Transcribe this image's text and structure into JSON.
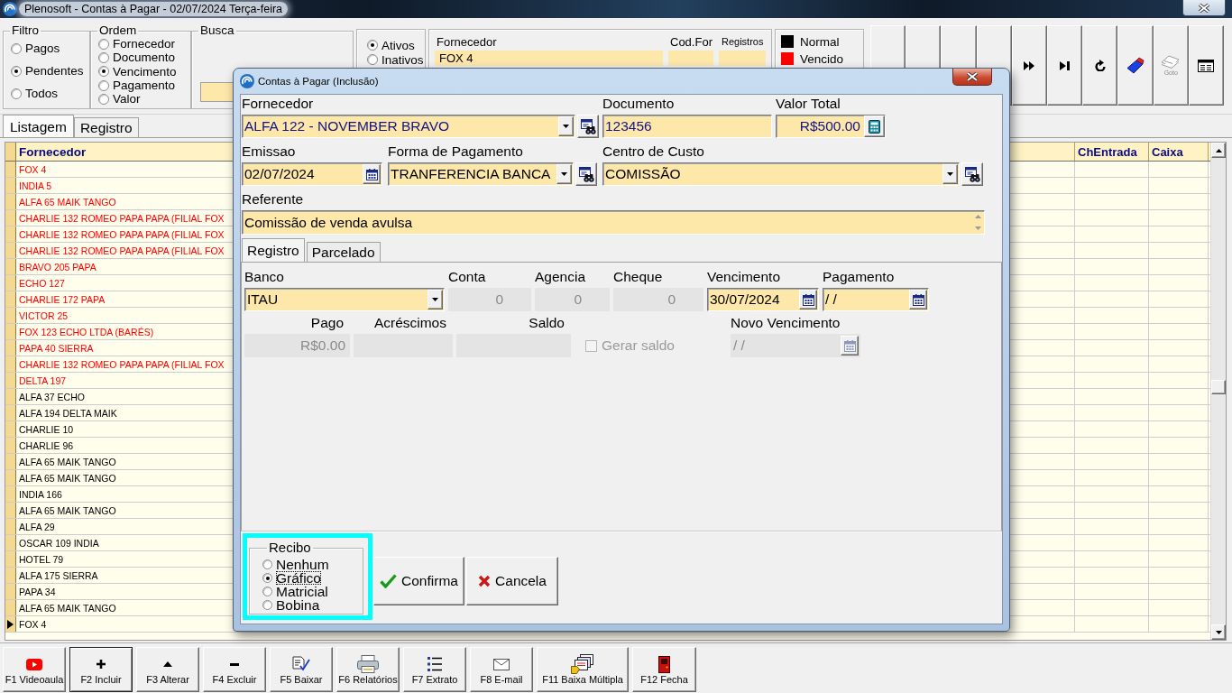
{
  "window": {
    "title": "Plenosoft - Contas à Pagar - 02/07/2024 Terça-feira"
  },
  "filter": {
    "legend": "Filtro",
    "options": [
      {
        "label": "Pagos",
        "selected": false
      },
      {
        "label": "Pendentes",
        "selected": true
      },
      {
        "label": "Todos",
        "selected": false
      }
    ]
  },
  "order": {
    "legend": "Ordem",
    "options": [
      {
        "label": "Fornecedor",
        "selected": false
      },
      {
        "label": "Documento",
        "selected": false
      },
      {
        "label": "Vencimento",
        "selected": true
      },
      {
        "label": "Pagamento",
        "selected": false
      },
      {
        "label": "Valor",
        "selected": false
      }
    ]
  },
  "search": {
    "legend": "Busca"
  },
  "activity": {
    "options": [
      {
        "label": "Ativos",
        "selected": true
      },
      {
        "label": "Inativos",
        "selected": false
      }
    ]
  },
  "lookup_fields": [
    {
      "label": "Fornecedor",
      "value": "FOX 4"
    },
    {
      "label": "Cod.For"
    },
    {
      "label": "Registros"
    }
  ],
  "status_legend": [
    {
      "label": "Normal",
      "color": "#000000"
    },
    {
      "label": "Vencido",
      "color": "#ff0000"
    }
  ],
  "nav_buttons": [
    {
      "kind": "blank"
    },
    {
      "kind": "blank"
    },
    {
      "kind": "blank"
    },
    {
      "kind": "blank"
    },
    {
      "kind": "next"
    },
    {
      "kind": "last"
    },
    {
      "kind": "refresh"
    },
    {
      "kind": "eraser"
    },
    {
      "kind": "goto",
      "caption": "Goto"
    },
    {
      "kind": "form"
    }
  ],
  "tabs": [
    {
      "label": "Listagem",
      "selected": true
    },
    {
      "label": "Registro",
      "selected": false
    }
  ],
  "table": {
    "columns": [
      "Fornecedor",
      "ChEntrada",
      "Caixa"
    ],
    "rows": [
      {
        "supplier": "FOX 4",
        "overdue": true,
        "selected": false
      },
      {
        "supplier": "INDIA 5",
        "overdue": true,
        "selected": false
      },
      {
        "supplier": "ALFA 65 MAIK TANGO",
        "overdue": true,
        "selected": false
      },
      {
        "supplier": "CHARLIE 132 ROMEO PAPA PAPA (FILIAL FOX",
        "overdue": true,
        "selected": false
      },
      {
        "supplier": "CHARLIE 132 ROMEO PAPA PAPA (FILIAL FOX",
        "overdue": true,
        "selected": false
      },
      {
        "supplier": "CHARLIE 132 ROMEO PAPA PAPA (FILIAL FOX",
        "overdue": true,
        "selected": false
      },
      {
        "supplier": "BRAVO 205 PAPA",
        "overdue": true,
        "selected": false
      },
      {
        "supplier": "ECHO 127",
        "overdue": true,
        "selected": false
      },
      {
        "supplier": "CHARLIE 172 PAPA",
        "overdue": true,
        "selected": false
      },
      {
        "supplier": "VICTOR 25",
        "overdue": true,
        "selected": false
      },
      {
        "supplier": "FOX 123 ECHO LTDA (BARÉS)",
        "overdue": true,
        "selected": false
      },
      {
        "supplier": "PAPA 40 SIERRA",
        "overdue": true,
        "selected": false
      },
      {
        "supplier": "CHARLIE 132 ROMEO PAPA PAPA (FILIAL FOX",
        "overdue": true,
        "selected": false
      },
      {
        "supplier": "DELTA 197",
        "overdue": true,
        "selected": false
      },
      {
        "supplier": "ALFA 37 ECHO",
        "overdue": false,
        "selected": false
      },
      {
        "supplier": "ALFA 194 DELTA MAIK",
        "overdue": false,
        "selected": false
      },
      {
        "supplier": "CHARLIE 10",
        "overdue": false,
        "selected": false
      },
      {
        "supplier": "CHARLIE 96",
        "overdue": false,
        "selected": false
      },
      {
        "supplier": "ALFA 65 MAIK TANGO",
        "overdue": false,
        "selected": false
      },
      {
        "supplier": "ALFA 65 MAIK TANGO",
        "overdue": false,
        "selected": false
      },
      {
        "supplier": "INDIA 166",
        "overdue": false,
        "selected": false
      },
      {
        "supplier": "ALFA 65 MAIK TANGO",
        "overdue": false,
        "selected": false
      },
      {
        "supplier": "ALFA 29",
        "overdue": false,
        "selected": false
      },
      {
        "supplier": "OSCAR 109 INDIA",
        "overdue": false,
        "selected": false
      },
      {
        "supplier": "HOTEL 79",
        "overdue": false,
        "selected": false
      },
      {
        "supplier": "ALFA 175 SIERRA",
        "overdue": false,
        "selected": false
      },
      {
        "supplier": "PAPA 34",
        "overdue": false,
        "selected": false
      },
      {
        "supplier": "ALFA 65 MAIK TANGO",
        "overdue": false,
        "selected": false
      },
      {
        "supplier": "FOX 4",
        "overdue": false,
        "selected": true
      }
    ]
  },
  "function_keys": [
    {
      "label": "F1 Videoaula",
      "kind": "video",
      "focused": false
    },
    {
      "label": "F2 Incluir",
      "kind": "add",
      "focused": true
    },
    {
      "label": "F3 Alterar",
      "kind": "edit",
      "focused": false
    },
    {
      "label": "F4 Excluir",
      "kind": "delete",
      "focused": false
    },
    {
      "label": "F5 Baixar",
      "kind": "settle",
      "focused": false
    },
    {
      "label": "F6 Relatórios",
      "kind": "reports",
      "focused": false
    },
    {
      "label": "F7 Extrato",
      "kind": "statement",
      "focused": false
    },
    {
      "label": "F8 E-mail",
      "kind": "email",
      "focused": false
    },
    {
      "label": "F11 Baixa Múltipla",
      "kind": "batch",
      "focused": false
    },
    {
      "label": "F12 Fecha",
      "kind": "exit",
      "focused": false
    }
  ],
  "dialog": {
    "title": "Contas à Pagar (Inclusão)",
    "field_rows": [
      [
        {
          "label": "Fornecedor",
          "value": "ALFA 122 - NOVEMBER BRAVO",
          "kind": "combo",
          "lookup": true,
          "disabled": false
        },
        {
          "label": "Documento",
          "value": "123456",
          "kind": "text",
          "disabled": false
        },
        {
          "label": "Valor Total",
          "value": "R$500.00",
          "kind": "number",
          "calculator": true,
          "disabled": false
        }
      ],
      [
        {
          "label": "Emissao",
          "value": "02/07/2024",
          "kind": "text",
          "calendar": true,
          "disabled": false
        },
        {
          "label": "Forma de Pagamento",
          "value": "TRANFERENCIA BANCA",
          "kind": "combo",
          "lookup": true,
          "disabled": false
        },
        {
          "label": "Centro de Custo",
          "value": "COMISSÃO",
          "kind": "combo",
          "lookup": true,
          "disabled": false
        }
      ],
      [
        {
          "label": "Referente",
          "value": "Comissão de venda avulsa",
          "kind": "memo",
          "disabled": false
        }
      ]
    ],
    "tabs": [
      {
        "label": "Registro",
        "selected": true
      },
      {
        "label": "Parcelado",
        "selected": false
      }
    ],
    "tab_rows": [
      [
        {
          "label": "Banco",
          "value": "ITAU",
          "kind": "combo",
          "disabled": false
        },
        {
          "label": "Conta",
          "value": "0",
          "kind": "number",
          "disabled": true
        },
        {
          "label": "Agencia",
          "value": "0",
          "kind": "number",
          "disabled": true
        },
        {
          "label": "Cheque",
          "value": "0",
          "kind": "number",
          "disabled": true
        },
        {
          "label": "Vencimento",
          "value": "30/07/2024",
          "kind": "text",
          "calendar": true,
          "disabled": false
        },
        {
          "label": "Pagamento",
          "value": "/ /",
          "kind": "text",
          "calendar": true,
          "disabled": false
        }
      ],
      [
        {
          "label": "Pago",
          "value": "R$0.00",
          "kind": "number",
          "disabled": true
        },
        {
          "label": "Acréscimos",
          "kind": "number",
          "disabled": true
        },
        {
          "label": "Saldo",
          "kind": "number",
          "disabled": true
        },
        {
          "label": "Gerar saldo",
          "kind": "check",
          "checked": false,
          "disabled": true
        },
        {
          "label": "Novo Vencimento",
          "value": "/ /",
          "kind": "text",
          "calendar": true,
          "disabled": true
        }
      ]
    ],
    "receipt": {
      "legend": "Recibo",
      "highlighted": true,
      "options": [
        {
          "label": "Nenhum",
          "selected": false
        },
        {
          "label": "Gráfico",
          "selected": true
        },
        {
          "label": "Matricial",
          "selected": false
        },
        {
          "label": "Bobina",
          "selected": false
        }
      ]
    },
    "buttons": [
      {
        "label": "Confirma",
        "kind": "confirm"
      },
      {
        "label": "Cancela",
        "kind": "cancel"
      }
    ]
  }
}
